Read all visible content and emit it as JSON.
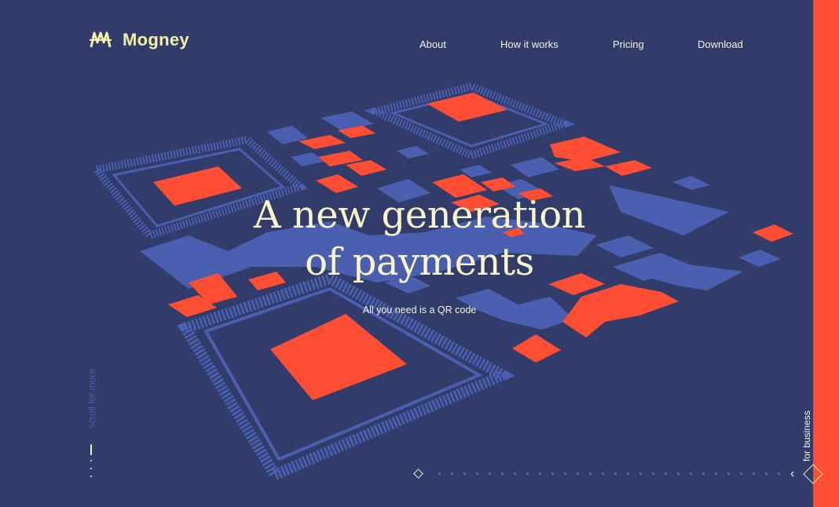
{
  "brand": {
    "name": "Mogney",
    "logo_icon": "mogney-m-icon"
  },
  "nav": {
    "items": [
      {
        "label": "About"
      },
      {
        "label": "How it works"
      },
      {
        "label": "Pricing"
      },
      {
        "label": "Download"
      }
    ]
  },
  "hero": {
    "headline_line1": "A new generation",
    "headline_line2": "of payments",
    "subline": "All you need is a QR code"
  },
  "scroll_hint": {
    "label": "scroll for more"
  },
  "business_link": {
    "label": "for business"
  },
  "colors": {
    "background": "#313c6b",
    "accent_orange": "#ff4e33",
    "accent_blue": "#4a5fb0",
    "cream": "#f7efa9"
  }
}
